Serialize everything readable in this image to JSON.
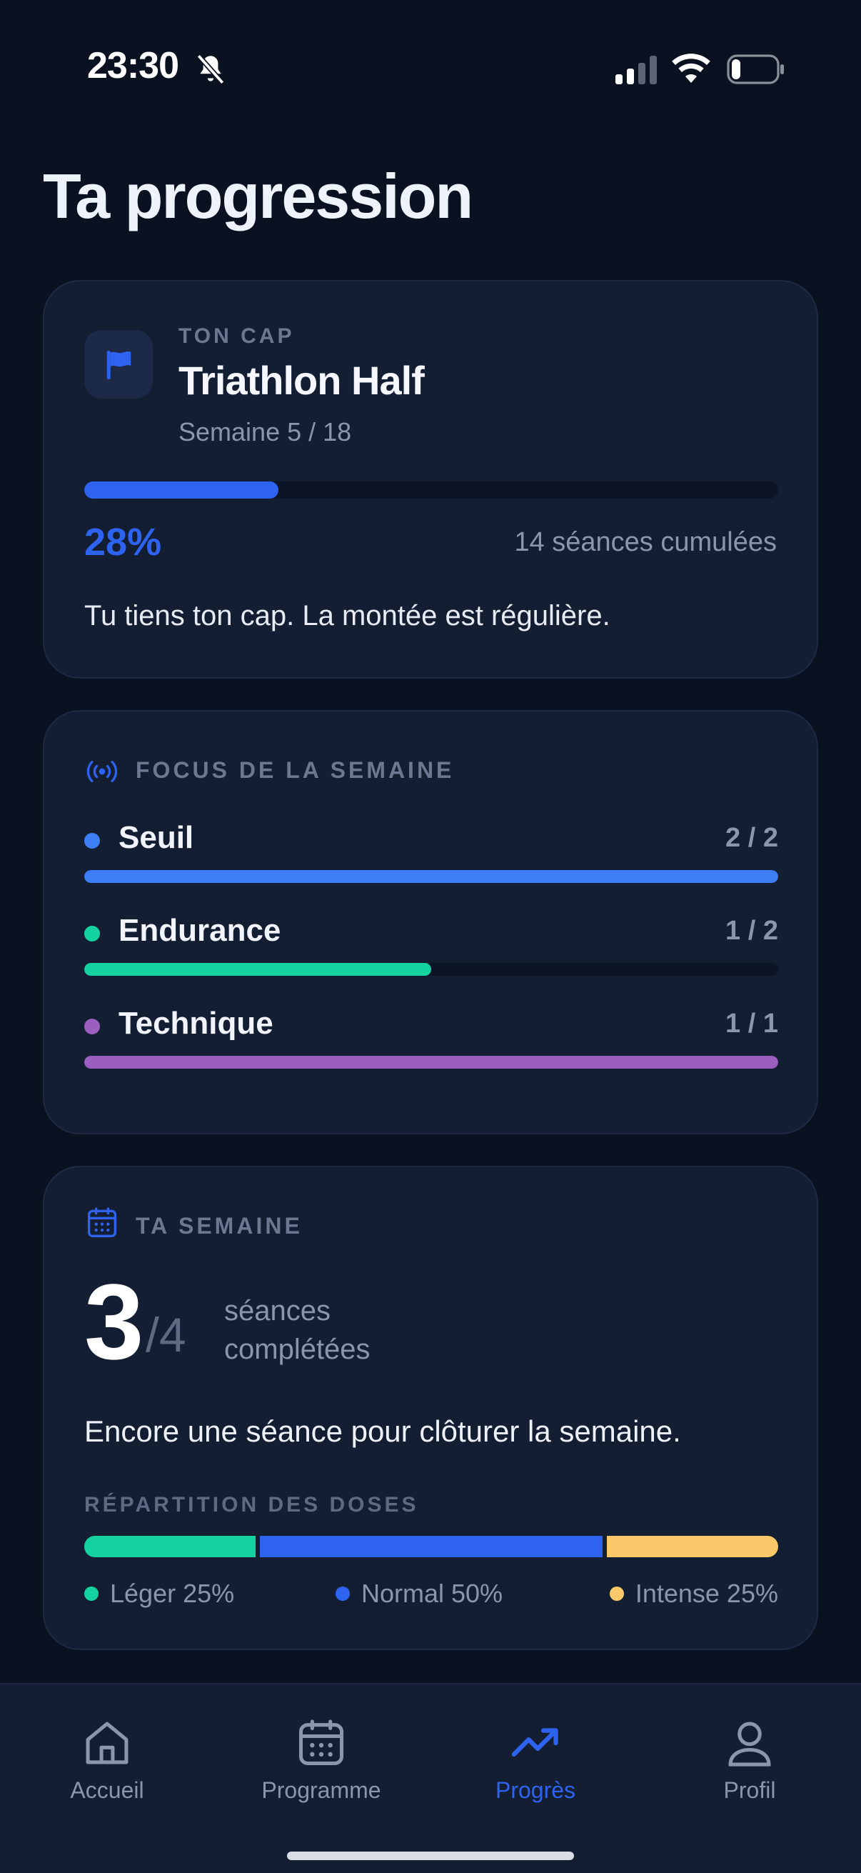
{
  "status_bar": {
    "time": "23:30"
  },
  "page_title": "Ta progression",
  "goal_card": {
    "label": "TON CAP",
    "title": "Triathlon Half",
    "week": "Semaine 5 / 18",
    "progress_percent": 28,
    "progress_label": "28%",
    "sessions": "14 séances cumulées",
    "message": "Tu tiens ton cap. La montée est régulière.",
    "accent_color": "#2e63f0"
  },
  "focus_card": {
    "label": "FOCUS DE LA SEMAINE",
    "items": [
      {
        "name": "Seuil",
        "count": "2 / 2",
        "done": 2,
        "total": 2,
        "color": "#3d7ef7"
      },
      {
        "name": "Endurance",
        "count": "1 / 2",
        "done": 1,
        "total": 2,
        "color": "#14d3a0"
      },
      {
        "name": "Technique",
        "count": "1 / 1",
        "done": 1,
        "total": 1,
        "color": "#9b5fc0"
      }
    ]
  },
  "week_card": {
    "label": "TA SEMAINE",
    "completed": "3",
    "total": "/4",
    "unit": "séances complétées",
    "message": "Encore une séance pour clôturer la semaine.",
    "dose_label": "RÉPARTITION DES DOSES",
    "doses": [
      {
        "label": "Léger 25%",
        "percent": 25,
        "color": "#14d3a0"
      },
      {
        "label": "Normal 50%",
        "percent": 50,
        "color": "#2e63f0"
      },
      {
        "label": "Intense 25%",
        "percent": 25,
        "color": "#fbc96a"
      }
    ]
  },
  "tab_bar": {
    "tabs": [
      {
        "label": "Accueil",
        "icon": "home-icon",
        "active": false
      },
      {
        "label": "Programme",
        "icon": "calendar-icon",
        "active": false
      },
      {
        "label": "Progrès",
        "icon": "trending-up-icon",
        "active": true
      },
      {
        "label": "Profil",
        "icon": "user-icon",
        "active": false
      }
    ],
    "active_color": "#2e63f0"
  }
}
